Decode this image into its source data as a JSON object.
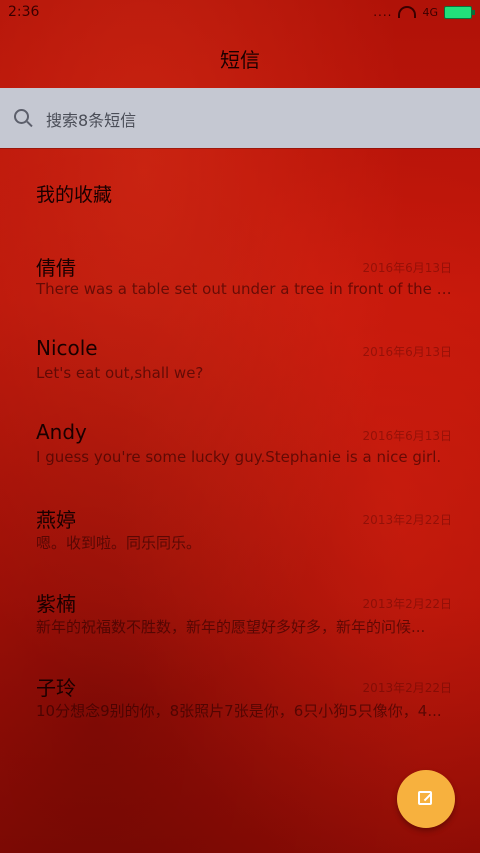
{
  "status_bar": {
    "time": "2:36",
    "dots": "....",
    "signal_label": "4G"
  },
  "header": {
    "title": "短信"
  },
  "search": {
    "placeholder": "搜索8条短信"
  },
  "favorites": {
    "label": "我的收藏"
  },
  "conversations": [
    {
      "name": "倩倩",
      "date": "2016年6月13日",
      "preview": "There was a table set out under a tree in front of the ho..."
    },
    {
      "name": "Nicole",
      "date": "2016年6月13日",
      "preview": "Let's eat out,shall we?"
    },
    {
      "name": "Andy",
      "date": "2016年6月13日",
      "preview": "I guess you're some lucky guy.Stephanie is a nice girl."
    },
    {
      "name": "燕婷",
      "date": "2013年2月22日",
      "preview": "嗯。收到啦。同乐同乐。"
    },
    {
      "name": "紫楠",
      "date": "2013年2月22日",
      "preview": "新年的祝福数不胜数，新年的愿望好多好多，新年的问候..."
    },
    {
      "name": "子玲",
      "date": "2013年2月22日",
      "preview": "10分想念9别的你，8张照片7张是你，6只小狗5只像你，4..."
    }
  ],
  "icons": {
    "search": "search-icon",
    "compose": "compose-icon",
    "wifi": "wifi-icon",
    "battery": "battery-icon"
  },
  "colors": {
    "fab": "#f7b13e",
    "battery": "#22e07a",
    "search_bar": "#c5c8d2"
  }
}
